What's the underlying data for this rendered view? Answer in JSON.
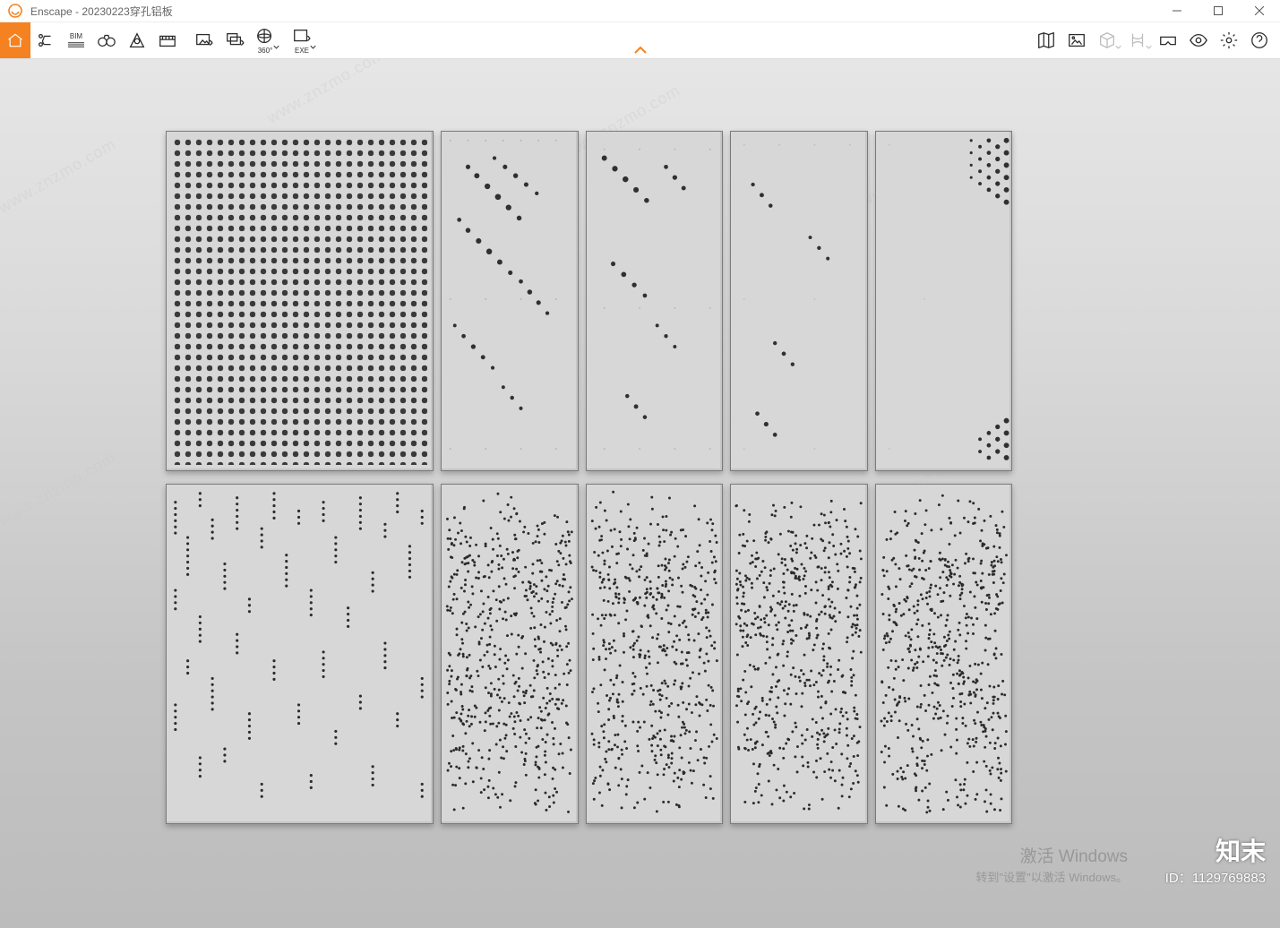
{
  "window": {
    "app_name": "Enscape",
    "title": "Enscape - 20230223穿孔铝板"
  },
  "toolbar": {
    "bim_label": "BIM",
    "exe_label": "EXE",
    "angle_label": "360°"
  },
  "watermark": {
    "line1": "激活 Windows",
    "line2": "转到\"设置\"以激活 Windows。",
    "site": "www.znzmo.com",
    "brand_logo": "知末",
    "id_label": "ID：1129769883"
  }
}
